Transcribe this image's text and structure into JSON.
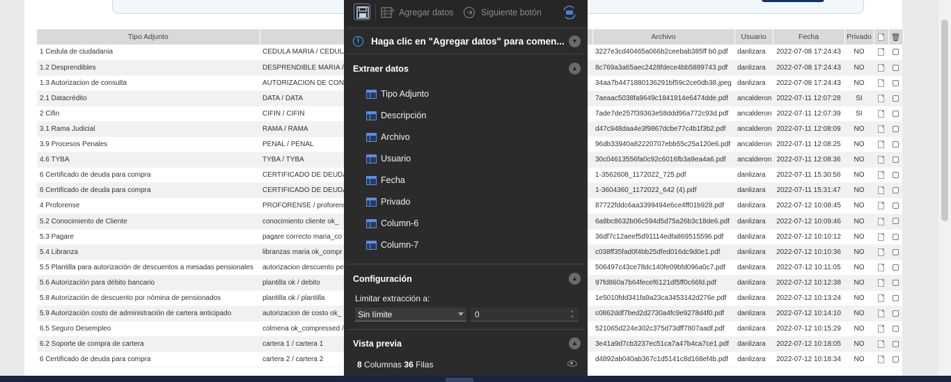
{
  "table": {
    "headers": [
      "Tipo Adjunto",
      "",
      "Archivo",
      "Usuario",
      "Fecha",
      "Privado"
    ],
    "rows": [
      {
        "tipo": "1 Cedula de ciudadania",
        "desc": "CEDULA MARIA / CEDULA",
        "archivo": "3227e3cd40465a066b2ceebab385ff b0.pdf",
        "usuario": "danlizara",
        "fecha": "2022-07-08 17:24:43",
        "privado": "NO"
      },
      {
        "tipo": "1.2 Desprendibles",
        "desc": "DESPRENDIBLE MARIA / D",
        "archivo": "8c769a3a65aec2428fdece4bb5889743.pdf",
        "usuario": "danlizara",
        "fecha": "2022-07-08 17:24:43",
        "privado": "NO"
      },
      {
        "tipo": "1.3 Autorizacion de consulta",
        "desc": "AUTORIZACION DE CONSU",
        "archivo": "34aa7b4471880136291bf59c2ce0db38.jpeg",
        "usuario": "danlizara",
        "fecha": "2022-07-08 17:24:43",
        "privado": "NO"
      },
      {
        "tipo": "2.1 Datacrédito",
        "desc": "DATA / DATA",
        "archivo": "7aeaac5038fa9649c1841914e6474dde.pdf",
        "usuario": "ancalderon",
        "fecha": "2022-07-11 12:07:28",
        "privado": "SI"
      },
      {
        "tipo": "2 Cifin",
        "desc": "CIFIN / CIFIN",
        "archivo": "7ade7de257f39363e58ddd96a772c93d.pdf",
        "usuario": "ancalderon",
        "fecha": "2022-07-11 12:07:39",
        "privado": "SI"
      },
      {
        "tipo": "3.1 Rama Judicial",
        "desc": "RAMA / RAMA",
        "archivo": "d47c948daa4e3f9867dcbe77c4b1f3b2.pdf",
        "usuario": "ancalderon",
        "fecha": "2022-07-11 12:08:09",
        "privado": "NO"
      },
      {
        "tipo": "3.9 Procesos Penales",
        "desc": "PENAL / PENAL",
        "archivo": "96db33940a82220707ebb55c25a120e6.pdf",
        "usuario": "ancalderon",
        "fecha": "2022-07-11 12:08:25",
        "privado": "NO"
      },
      {
        "tipo": "4.6 TYBA",
        "desc": "TYBA / TYBA",
        "archivo": "30c04613556fa0c92c6016fb3a9ea4a6.pdf",
        "usuario": "ancalderon",
        "fecha": "2022-07-11 12:08:36",
        "privado": "NO"
      },
      {
        "tipo": "6 Certificado de deuda para compra",
        "desc": "CERTIFICADO DE DEUDA",
        "archivo": "1-3562608_1172022_725.pdf",
        "usuario": "danlizara",
        "fecha": "2022-07-11 15:30:56",
        "privado": "NO"
      },
      {
        "tipo": "6 Certificado de deuda para compra",
        "desc": "CERTIFICADO DE DEUDA",
        "archivo": "1-3604360_1172022_642 (4).pdf",
        "usuario": "danlizara",
        "fecha": "2022-07-11 15:31:47",
        "privado": "NO"
      },
      {
        "tipo": "4 Proforense",
        "desc": "PROFORENSE / proforens",
        "archivo": "87722fddc6aa3399494e6ce4ff01b928.pdf",
        "usuario": "danlizara",
        "fecha": "2022-07-12 10:08:45",
        "privado": "NO"
      },
      {
        "tipo": "5.2 Conocimiento de Cliente",
        "desc": "conocimiento cliente ok_",
        "archivo": "6a8bc8632b06c594d5d75a26b3c18de6.pdf",
        "usuario": "danlizara",
        "fecha": "2022-07-12 10:09:46",
        "privado": "NO"
      },
      {
        "tipo": "5.3 Pagare",
        "desc": "pagare correcto maria_co",
        "archivo": "36df7c12aeef5d91114edfa869515596.pdf",
        "usuario": "danlizara",
        "fecha": "2022-07-12 10:10:12",
        "privado": "NO"
      },
      {
        "tipo": "5.4 Libranza",
        "desc": "libranzas maria ok_compr",
        "archivo": "c038ff35fad0f4bb25dfed016dc9d0e1.pdf",
        "usuario": "danlizara",
        "fecha": "2022-07-12 10:10:36",
        "privado": "NO"
      },
      {
        "tipo": "5.5 Plantilla para autorización de descuentos a mesadas pensionales",
        "desc": "autorizacion descuento pe",
        "archivo": "506497c43ce78dc140fe09bfd096a0c7.pdf",
        "usuario": "danlizara",
        "fecha": "2022-07-12 10:11:05",
        "privado": "NO"
      },
      {
        "tipo": "5.6 Autorización para débito bancario",
        "desc": "plantilla ok / debito",
        "archivo": "97fd860a7b64fecef6121df5ff0c66fd.pdf",
        "usuario": "danlizara",
        "fecha": "2022-07-12 10:12:38",
        "privado": "NO"
      },
      {
        "tipo": "5.8 Autorización de descuento por nómina de pensionados",
        "desc": "plantilla ok / plantilla",
        "archivo": "1e5010fdd341fa9a23ca3453142d276e.pdf",
        "usuario": "danlizara",
        "fecha": "2022-07-12 10:13:24",
        "privado": "NO"
      },
      {
        "tipo": "5.9 Autorización costo de administración de cartera anticipado",
        "desc": "autorizacion de costo ok_",
        "archivo": "c0862ddf7bed2d2730a4fc9e9278d4f0.pdf",
        "usuario": "danlizara",
        "fecha": "2022-07-12 10:14:10",
        "privado": "NO"
      },
      {
        "tipo": "6.5 Seguro Desempleo",
        "desc": "colmena ok_compressed /",
        "archivo": "521065d224e302c375d73dff7807aadf.pdf",
        "usuario": "danlizara",
        "fecha": "2022-07-12 10:15:29",
        "privado": "NO"
      },
      {
        "tipo": "6.2 Soporte de compra de cartera",
        "desc": "cartera 1 / cartera 1",
        "archivo": "3e41a9d7cb3237ec51ca7a47b4ca7ce1.pdf",
        "usuario": "danlizara",
        "fecha": "2022-07-12 10:18:05",
        "privado": "NO"
      },
      {
        "tipo": "6 Certificado de deuda para compra",
        "desc": "cartera 2 / cartera 2",
        "archivo": "d4892ab040ab367c1d5141c8d168ef4b.pdf",
        "usuario": "danlizara",
        "fecha": "2022-07-12 10:18:34",
        "privado": "NO"
      }
    ]
  },
  "panel": {
    "toolbar": {
      "add_data": "Agregar datos",
      "next_button": "Siguiente botón"
    },
    "info_text": "Haga clic en \"Agregar datos\" para comen...",
    "extract": {
      "title": "Extraer datos",
      "fields": [
        "Tipo Adjunto",
        "Descripción",
        "Archivo",
        "Usuario",
        "Fecha",
        "Privado",
        "Column-6",
        "Column-7"
      ]
    },
    "config": {
      "title": "Configuración",
      "limit_label": "Limitar extracción a:",
      "limit_value": "Sin límite",
      "limit_number": "0"
    },
    "preview": {
      "title": "Vista previa",
      "columns": "8",
      "columns_label": "Columnas",
      "rows": "36",
      "rows_label": "Filas"
    }
  },
  "colors": {
    "panel_bg": "#2b2b2b",
    "accent_blue": "#4a9fff",
    "header_gray": "#d9d9d9",
    "taskbar": "#1a2440"
  }
}
